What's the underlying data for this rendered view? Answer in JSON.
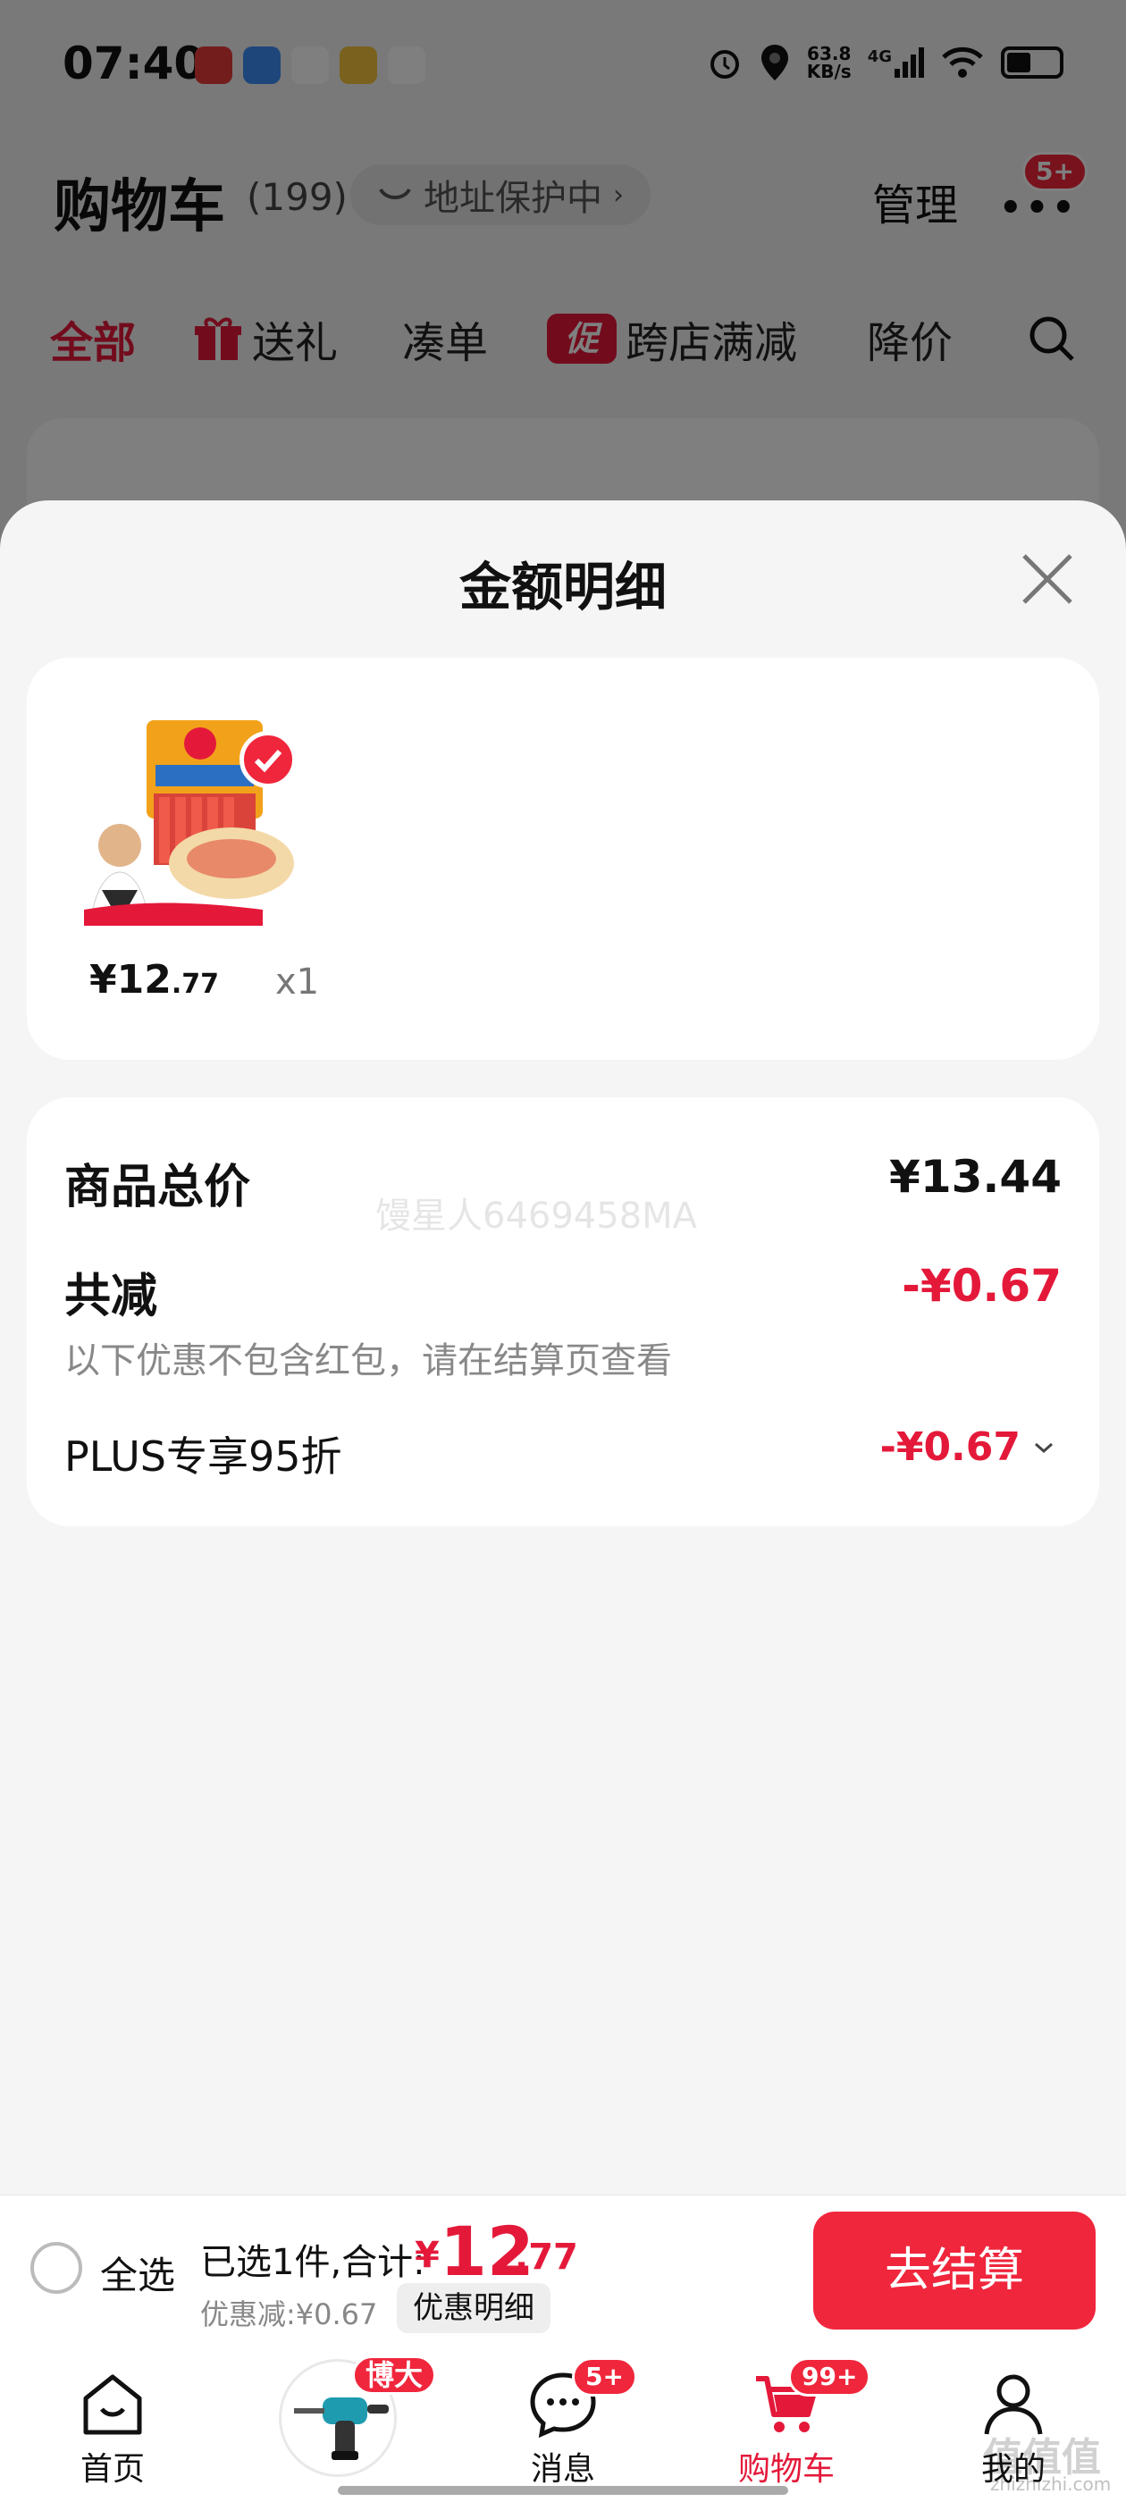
{
  "status_bar": {
    "time": "07:40",
    "net_speed_value": "63.8",
    "net_speed_unit": "KB/s",
    "network": "4G"
  },
  "cart": {
    "title": "购物车",
    "count": "(199)",
    "address_protect": "地址保护中",
    "manage": "管理",
    "more_badge": "5+"
  },
  "filter_tabs": [
    "全部",
    "送礼",
    "凑单",
    "促",
    "跨店满减",
    "降价"
  ],
  "sheet": {
    "title": "金额明细",
    "product": {
      "price_symbol": "¥",
      "price_int": "12",
      "price_dec": ".77",
      "qty": "x1"
    },
    "summary": {
      "total_label": "商品总价",
      "total_value": "¥13.44",
      "reduce_label": "共减",
      "reduce_value": "-¥0.67",
      "reduce_note": "以下优惠不包含红包，请在结算页查看",
      "plus_label": "PLUS专享95折",
      "plus_value": "-¥0.67",
      "watermark": "馒星人6469458MA"
    }
  },
  "checkout": {
    "select_all": "全选",
    "selected": "已选1件,合计:",
    "currency": "¥",
    "total_int": "12",
    "total_dec": ".77",
    "discount": "优惠减:¥0.67",
    "discount_detail": "优惠明细",
    "submit": "去结算"
  },
  "tabbar": {
    "home": "首页",
    "promo_badge": "博大",
    "messages": "消息",
    "messages_badge": "5+",
    "cart": "购物车",
    "cart_badge": "99+",
    "mine": "我的"
  },
  "corner_watermark": "值值值",
  "corner_watermark_sub": "zhizhizhi.com",
  "colors": {
    "accent_red": "#e4193a",
    "button_red": "#f0263c",
    "sheet_bg": "#f5f5f5"
  }
}
